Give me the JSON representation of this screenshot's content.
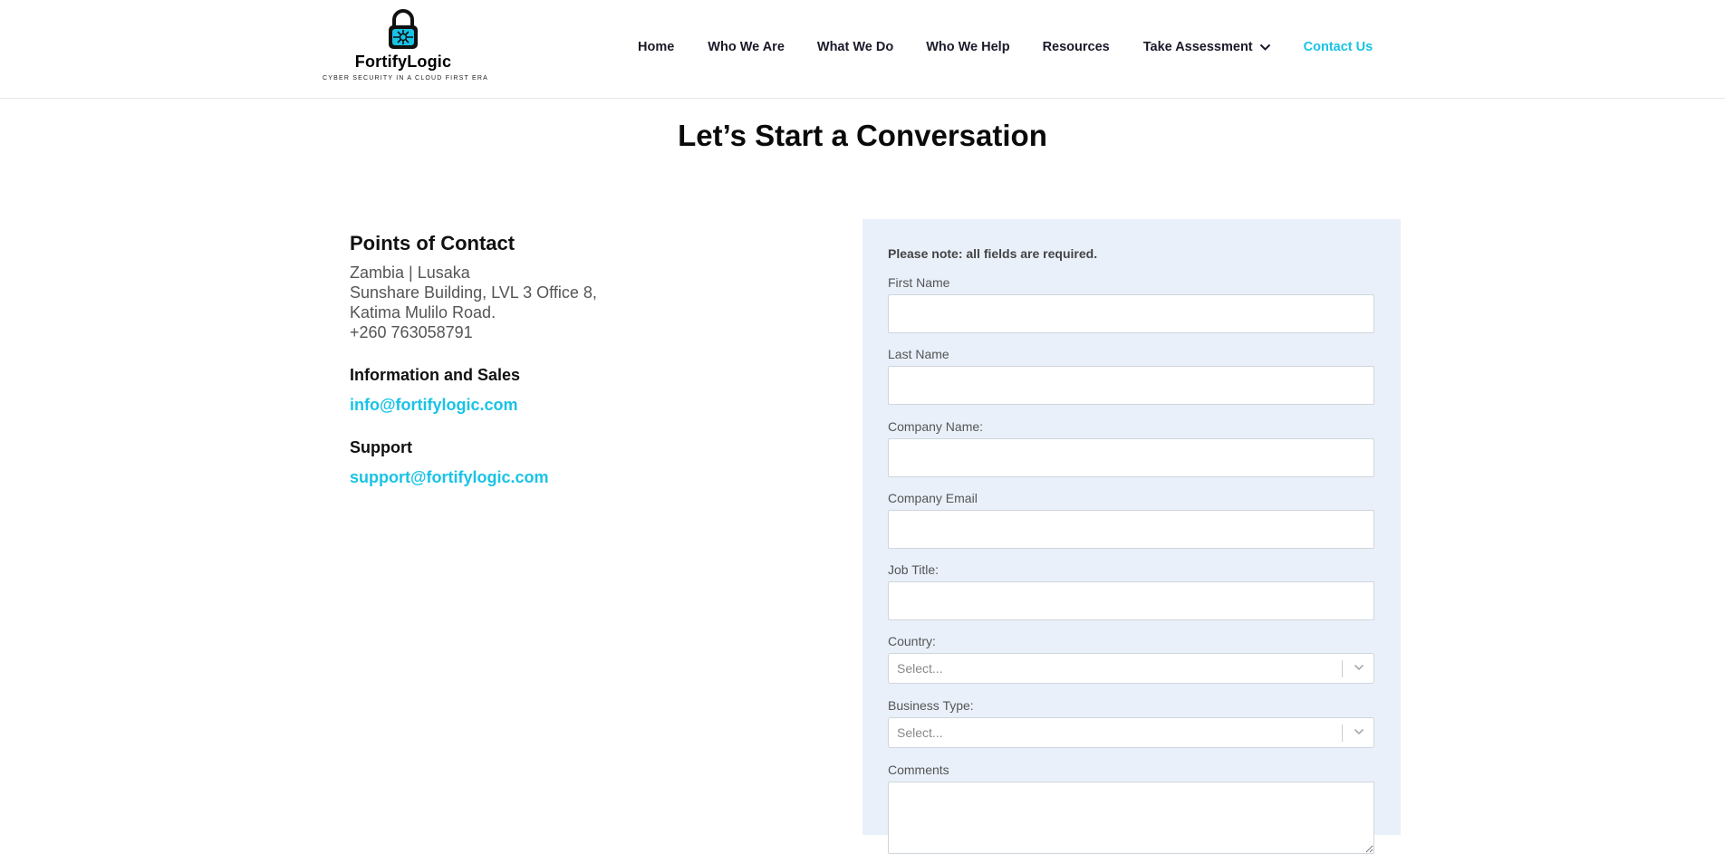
{
  "brand": {
    "name": "FortifyLogic",
    "tagline": "CYBER SECURITY IN A CLOUD FIRST ERA",
    "accent_color": "#19c3e6",
    "icon": "padlock-icon"
  },
  "nav": {
    "items": [
      {
        "label": "Home"
      },
      {
        "label": "Who We Are"
      },
      {
        "label": "What We Do"
      },
      {
        "label": "Who We Help"
      },
      {
        "label": "Resources"
      },
      {
        "label": "Take Assessment",
        "icon": "chevron-down-icon"
      },
      {
        "label": "Contact Us",
        "active": true
      }
    ]
  },
  "page": {
    "title": "Let’s Start a Conversation"
  },
  "contact": {
    "heading": "Points of Contact",
    "address": [
      "Zambia | Lusaka",
      "Sunshare Building, LVL 3 Office 8,",
      "Katima Mulilo Road.",
      "+260 763058791"
    ],
    "sales": {
      "heading": "Information and Sales",
      "email": "info@fortifylogic.com"
    },
    "support": {
      "heading": "Support",
      "email": "support@fortifylogic.com"
    }
  },
  "form": {
    "note": "Please note: all fields are required.",
    "fields": {
      "first_name": {
        "label": "First Name",
        "value": ""
      },
      "last_name": {
        "label": "Last Name",
        "value": ""
      },
      "company_name": {
        "label": "Company Name:",
        "value": ""
      },
      "company_email": {
        "label": "Company Email",
        "value": ""
      },
      "job_title": {
        "label": "Job Title:",
        "value": ""
      },
      "country": {
        "label": "Country:",
        "placeholder": "Select..."
      },
      "business_type": {
        "label": "Business Type:",
        "placeholder": "Select..."
      },
      "comments": {
        "label": "Comments",
        "value": ""
      }
    }
  }
}
